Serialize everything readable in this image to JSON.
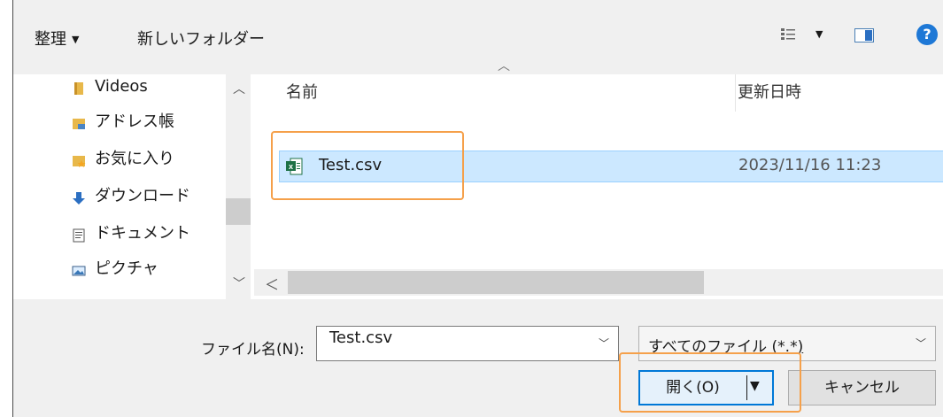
{
  "toolbar": {
    "organize_label": "整理",
    "new_folder_label": "新しいフォルダー"
  },
  "nav": {
    "items": [
      {
        "label": "Videos",
        "icon": "folder-icon"
      },
      {
        "label": "アドレス帳",
        "icon": "contacts-folder-icon"
      },
      {
        "label": "お気に入り",
        "icon": "favorites-folder-icon"
      },
      {
        "label": "ダウンロード",
        "icon": "download-arrow-icon"
      },
      {
        "label": "ドキュメント",
        "icon": "documents-icon"
      },
      {
        "label": "ピクチャ",
        "icon": "pictures-icon"
      }
    ]
  },
  "filelist": {
    "columns": {
      "name": "名前",
      "date": "更新日時"
    },
    "rows": [
      {
        "name": "Test.csv",
        "date": "2023/11/16 11:23",
        "icon": "excel-csv-icon"
      }
    ]
  },
  "footer": {
    "filename_label": "ファイル名(N):",
    "filename_value": "Test.csv",
    "filetype_value": "すべてのファイル (*.*)",
    "open_label": "開く(O)",
    "cancel_label": "キャンセル"
  },
  "colors": {
    "accent": "#0078d7",
    "selection_bg": "#cce8ff",
    "annotation": "#f5a04a"
  }
}
